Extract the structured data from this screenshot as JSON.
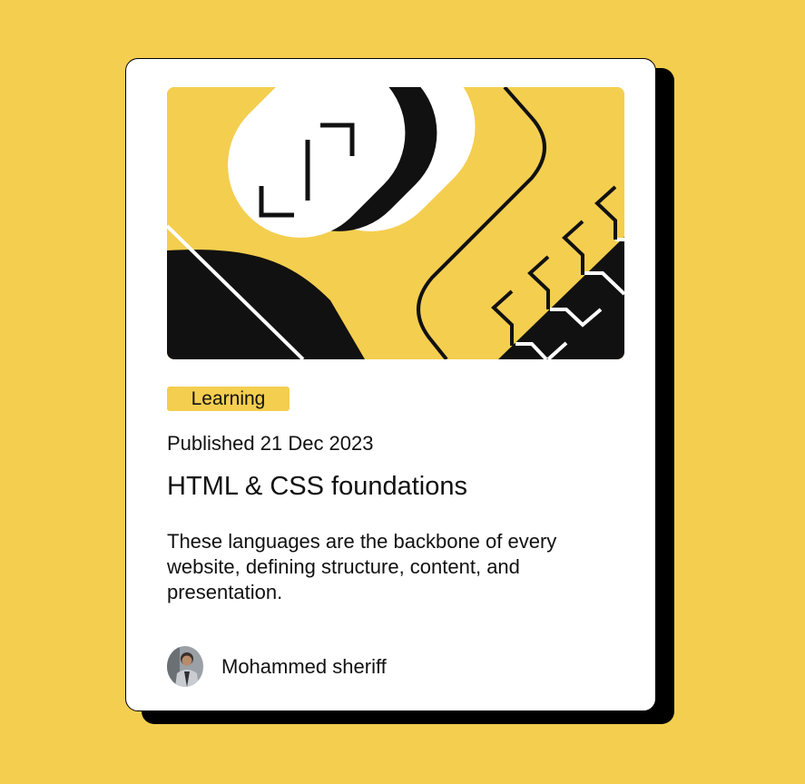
{
  "colors": {
    "page_background": "#f4ce4f",
    "card_background": "#ffffff",
    "shadow": "#000000",
    "tag_background": "#f4ce4f",
    "text": "#111111"
  },
  "card": {
    "image_icon": "abstract-code-illustration",
    "tag": "Learning",
    "published": "Published 21 Dec 2023",
    "title": "HTML & CSS foundations",
    "description": "These languages are the backbone of every website, defining structure, content, and presentation.",
    "author": {
      "name": "Mohammed sheriff",
      "avatar_icon": "person-avatar"
    }
  }
}
